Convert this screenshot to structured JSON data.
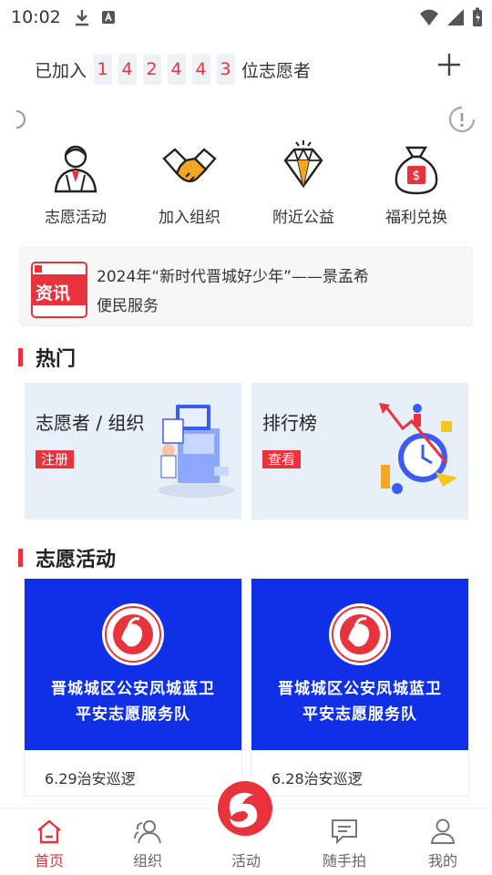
{
  "status_bar": {
    "time": "10:02"
  },
  "counter": {
    "prefix": "已加入",
    "digits": [
      "1",
      "4",
      "2",
      "4",
      "4",
      "3"
    ],
    "suffix": "位志愿者"
  },
  "quick_actions": [
    {
      "label": "志愿活动",
      "icon": "volunteer-person-icon"
    },
    {
      "label": "加入组织",
      "icon": "handshake-icon"
    },
    {
      "label": "附近公益",
      "icon": "diamond-icon"
    },
    {
      "label": "福利兑换",
      "icon": "money-bag-icon"
    }
  ],
  "news": {
    "badge": "资讯",
    "line1": "2024年“新时代晋城好少年”——景孟希",
    "line2": "便民服务"
  },
  "hot_section": {
    "title": "热门",
    "cards": [
      {
        "title": "志愿者 / 组织",
        "tag": "注册"
      },
      {
        "title": "排行榜",
        "tag": "查看"
      }
    ]
  },
  "activity_section": {
    "title": "志愿活动",
    "cards": [
      {
        "banner_line1": "晋城城区公安凤城蓝卫",
        "banner_line2": "平安志愿服务队",
        "caption": "6.29治安巡逻"
      },
      {
        "banner_line1": "晋城城区公安凤城蓝卫",
        "banner_line2": "平安志愿服务队",
        "caption": "6.28治安巡逻"
      }
    ]
  },
  "tab_bar": [
    {
      "label": "首页",
      "icon": "home-icon",
      "active": true
    },
    {
      "label": "组织",
      "icon": "group-icon",
      "active": false
    },
    {
      "label": "活动",
      "icon": "activity-logo-icon",
      "active": false
    },
    {
      "label": "随手拍",
      "icon": "chat-icon",
      "active": false
    },
    {
      "label": "我的",
      "icon": "profile-icon",
      "active": false
    }
  ],
  "colors": {
    "accent": "#e8323c",
    "banner_blue": "#1030e8",
    "card_bg": "#e7f0f9"
  }
}
